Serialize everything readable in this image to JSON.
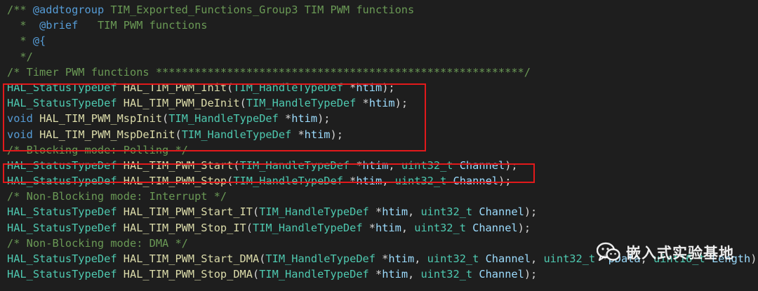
{
  "code_lines": [
    [
      {
        "t": "/** ",
        "c": "comment"
      },
      {
        "t": "@addtogroup",
        "c": "tag"
      },
      {
        "t": " TIM_Exported_Functions_Group3 TIM PWM functions",
        "c": "comment"
      }
    ],
    [
      {
        "t": "  *  ",
        "c": "comment"
      },
      {
        "t": "@brief",
        "c": "tag"
      },
      {
        "t": "   TIM PWM functions",
        "c": "comment"
      }
    ],
    [
      {
        "t": "  * ",
        "c": "comment"
      },
      {
        "t": "@{",
        "c": "tag"
      }
    ],
    [
      {
        "t": "  */",
        "c": "comment"
      }
    ],
    [
      {
        "t": "/* Timer PWM functions *********************************************************/",
        "c": "comment"
      }
    ],
    [
      {
        "t": "HAL_StatusTypeDef",
        "c": "type"
      },
      {
        "t": " ",
        "c": "punct"
      },
      {
        "t": "HAL_TIM_PWM_Init",
        "c": "func"
      },
      {
        "t": "(",
        "c": "punct"
      },
      {
        "t": "TIM_HandleTypeDef",
        "c": "type"
      },
      {
        "t": " *",
        "c": "punct"
      },
      {
        "t": "htim",
        "c": "param"
      },
      {
        "t": ");",
        "c": "punct"
      }
    ],
    [
      {
        "t": "HAL_StatusTypeDef",
        "c": "type"
      },
      {
        "t": " ",
        "c": "punct"
      },
      {
        "t": "HAL_TIM_PWM_DeInit",
        "c": "func"
      },
      {
        "t": "(",
        "c": "punct"
      },
      {
        "t": "TIM_HandleTypeDef",
        "c": "type"
      },
      {
        "t": " *",
        "c": "punct"
      },
      {
        "t": "htim",
        "c": "param"
      },
      {
        "t": ");",
        "c": "punct"
      }
    ],
    [
      {
        "t": "void",
        "c": "keyword"
      },
      {
        "t": " ",
        "c": "punct"
      },
      {
        "t": "HAL_TIM_PWM_MspInit",
        "c": "func"
      },
      {
        "t": "(",
        "c": "punct"
      },
      {
        "t": "TIM_HandleTypeDef",
        "c": "type"
      },
      {
        "t": " *",
        "c": "punct"
      },
      {
        "t": "htim",
        "c": "param"
      },
      {
        "t": ");",
        "c": "punct"
      }
    ],
    [
      {
        "t": "void",
        "c": "keyword"
      },
      {
        "t": " ",
        "c": "punct"
      },
      {
        "t": "HAL_TIM_PWM_MspDeInit",
        "c": "func"
      },
      {
        "t": "(",
        "c": "punct"
      },
      {
        "t": "TIM_HandleTypeDef",
        "c": "type"
      },
      {
        "t": " *",
        "c": "punct"
      },
      {
        "t": "htim",
        "c": "param"
      },
      {
        "t": ");",
        "c": "punct"
      }
    ],
    [
      {
        "t": "/* Blocking mode: Polling */",
        "c": "comment"
      }
    ],
    [
      {
        "t": "HAL_StatusTypeDef",
        "c": "type"
      },
      {
        "t": " ",
        "c": "punct"
      },
      {
        "t": "HAL_TIM_PWM_Start",
        "c": "func"
      },
      {
        "t": "(",
        "c": "punct"
      },
      {
        "t": "TIM_HandleTypeDef",
        "c": "type"
      },
      {
        "t": " *",
        "c": "punct"
      },
      {
        "t": "htim",
        "c": "param"
      },
      {
        "t": ", ",
        "c": "punct"
      },
      {
        "t": "uint32_t",
        "c": "type"
      },
      {
        "t": " ",
        "c": "punct"
      },
      {
        "t": "Channel",
        "c": "param"
      },
      {
        "t": ");",
        "c": "punct"
      }
    ],
    [
      {
        "t": "HAL_StatusTypeDef",
        "c": "type"
      },
      {
        "t": " ",
        "c": "punct"
      },
      {
        "t": "HAL_TIM_PWM_Stop",
        "c": "func"
      },
      {
        "t": "(",
        "c": "punct"
      },
      {
        "t": "TIM_HandleTypeDef",
        "c": "type"
      },
      {
        "t": " *",
        "c": "punct"
      },
      {
        "t": "htim",
        "c": "param"
      },
      {
        "t": ", ",
        "c": "punct"
      },
      {
        "t": "uint32_t",
        "c": "type"
      },
      {
        "t": " ",
        "c": "punct"
      },
      {
        "t": "Channel",
        "c": "param"
      },
      {
        "t": ");",
        "c": "punct"
      }
    ],
    [
      {
        "t": "/* Non-Blocking mode: Interrupt */",
        "c": "comment"
      }
    ],
    [
      {
        "t": "HAL_StatusTypeDef",
        "c": "type"
      },
      {
        "t": " ",
        "c": "punct"
      },
      {
        "t": "HAL_TIM_PWM_Start_IT",
        "c": "func"
      },
      {
        "t": "(",
        "c": "punct"
      },
      {
        "t": "TIM_HandleTypeDef",
        "c": "type"
      },
      {
        "t": " *",
        "c": "punct"
      },
      {
        "t": "htim",
        "c": "param"
      },
      {
        "t": ", ",
        "c": "punct"
      },
      {
        "t": "uint32_t",
        "c": "type"
      },
      {
        "t": " ",
        "c": "punct"
      },
      {
        "t": "Channel",
        "c": "param"
      },
      {
        "t": ");",
        "c": "punct"
      }
    ],
    [
      {
        "t": "HAL_StatusTypeDef",
        "c": "type"
      },
      {
        "t": " ",
        "c": "punct"
      },
      {
        "t": "HAL_TIM_PWM_Stop_IT",
        "c": "func"
      },
      {
        "t": "(",
        "c": "punct"
      },
      {
        "t": "TIM_HandleTypeDef",
        "c": "type"
      },
      {
        "t": " *",
        "c": "punct"
      },
      {
        "t": "htim",
        "c": "param"
      },
      {
        "t": ", ",
        "c": "punct"
      },
      {
        "t": "uint32_t",
        "c": "type"
      },
      {
        "t": " ",
        "c": "punct"
      },
      {
        "t": "Channel",
        "c": "param"
      },
      {
        "t": ");",
        "c": "punct"
      }
    ],
    [
      {
        "t": "/* Non-Blocking mode: DMA */",
        "c": "comment"
      }
    ],
    [
      {
        "t": "HAL_StatusTypeDef",
        "c": "type"
      },
      {
        "t": " ",
        "c": "punct"
      },
      {
        "t": "HAL_TIM_PWM_Start_DMA",
        "c": "func"
      },
      {
        "t": "(",
        "c": "punct"
      },
      {
        "t": "TIM_HandleTypeDef",
        "c": "type"
      },
      {
        "t": " *",
        "c": "punct"
      },
      {
        "t": "htim",
        "c": "param"
      },
      {
        "t": ", ",
        "c": "punct"
      },
      {
        "t": "uint32_t",
        "c": "type"
      },
      {
        "t": " ",
        "c": "punct"
      },
      {
        "t": "Channel",
        "c": "param"
      },
      {
        "t": ", ",
        "c": "punct"
      },
      {
        "t": "uint32_t",
        "c": "type"
      },
      {
        "t": " *",
        "c": "punct"
      },
      {
        "t": "pData",
        "c": "param"
      },
      {
        "t": ", ",
        "c": "punct"
      },
      {
        "t": "uint16_t",
        "c": "type"
      },
      {
        "t": " ",
        "c": "punct"
      },
      {
        "t": "Length",
        "c": "param"
      },
      {
        "t": ");",
        "c": "punct"
      }
    ],
    [
      {
        "t": "HAL_StatusTypeDef",
        "c": "type"
      },
      {
        "t": " ",
        "c": "punct"
      },
      {
        "t": "HAL_TIM_PWM_Stop_DMA",
        "c": "func"
      },
      {
        "t": "(",
        "c": "punct"
      },
      {
        "t": "TIM_HandleTypeDef",
        "c": "type"
      },
      {
        "t": " *",
        "c": "punct"
      },
      {
        "t": "htim",
        "c": "param"
      },
      {
        "t": ", ",
        "c": "punct"
      },
      {
        "t": "uint32_t",
        "c": "type"
      },
      {
        "t": " ",
        "c": "punct"
      },
      {
        "t": "Channel",
        "c": "param"
      },
      {
        "t": ");",
        "c": "punct"
      }
    ]
  ],
  "watermark": {
    "icon": "wechat-icon",
    "text": "嵌入式实验基地"
  },
  "colors": {
    "background": "#1e1e1e",
    "comment": "#6a9955",
    "type": "#4ec9b0",
    "function": "#dcdcaa",
    "keyword": "#569cd6",
    "parameter": "#9cdcfe",
    "highlight_border": "#e3191b"
  }
}
